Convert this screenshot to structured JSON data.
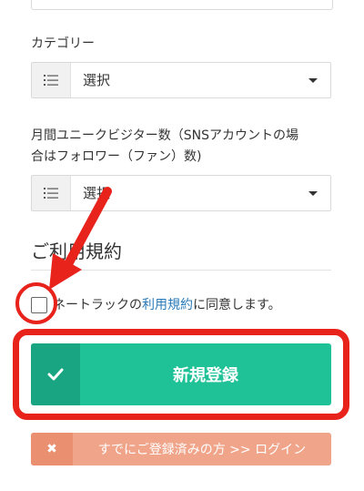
{
  "category": {
    "label": "カテゴリー",
    "value": "選択"
  },
  "unique_visitors": {
    "label_line1": "月間ユニークビジター数（SNSアカウントの場",
    "label_line2": "合はフォロワー（ファン）数)",
    "value": "選択"
  },
  "terms": {
    "section_title": "ご利用規約",
    "agree_prefix": "ネートラックの",
    "agree_link": "利用規約",
    "agree_suffix": "に同意します。"
  },
  "register_button": {
    "label": "新規登録",
    "icon": "check-icon"
  },
  "login_button": {
    "label": "すでにご登録済みの方 >> ログイン",
    "icon": "close-icon"
  },
  "colors": {
    "accent_green": "#1fc197",
    "login_salmon": "#f0a48a",
    "annotation_red": "#e8231c",
    "link_blue": "#2a7ab8"
  }
}
